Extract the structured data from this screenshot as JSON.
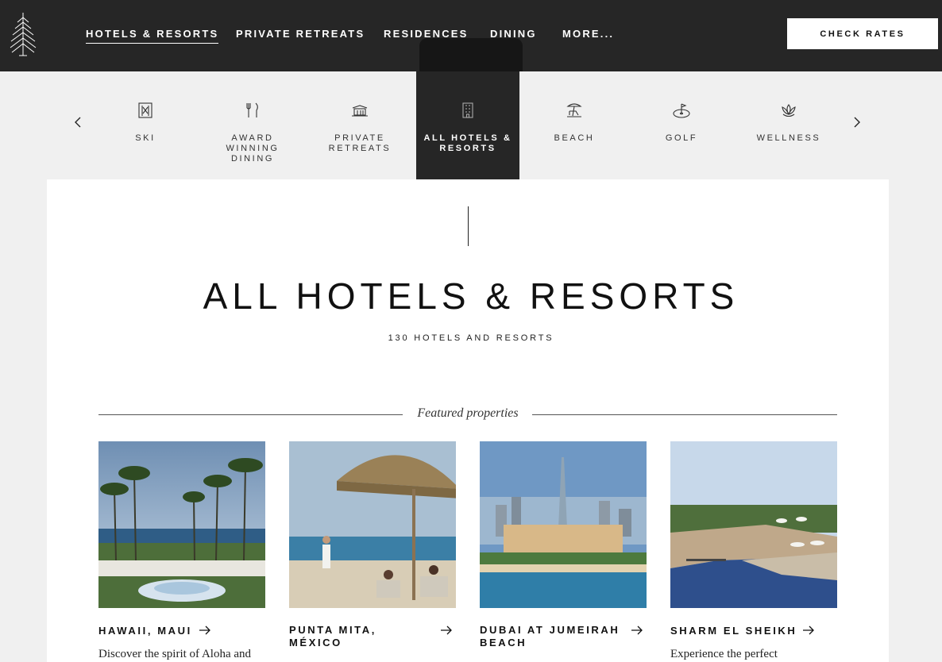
{
  "nav": {
    "items": [
      {
        "label": "HOTELS & RESORTS",
        "active": true
      },
      {
        "label": "PRIVATE RETREATS"
      },
      {
        "label": "RESIDENCES"
      },
      {
        "label": "DINING"
      },
      {
        "label": "MORE..."
      }
    ],
    "check_rates_label": "CHECK RATES"
  },
  "categories": {
    "items": [
      {
        "label": "SKI",
        "icon": "ski-icon"
      },
      {
        "label": "AWARD WINNING DINING",
        "icon": "utensils-icon"
      },
      {
        "label": "PRIVATE RETREATS",
        "icon": "villa-icon"
      },
      {
        "label": "ALL HOTELS & RESORTS",
        "icon": "building-icon",
        "active": true
      },
      {
        "label": "BEACH",
        "icon": "beach-chair-icon"
      },
      {
        "label": "GOLF",
        "icon": "golf-icon"
      },
      {
        "label": "WELLNESS",
        "icon": "lotus-icon"
      }
    ]
  },
  "main": {
    "title": "ALL HOTELS & RESORTS",
    "count": "130 HOTELS AND RESORTS",
    "featured_label": "Featured properties",
    "cards": [
      {
        "title": "HAWAII, MAUI",
        "desc": "Discover the spirit of Aloha and"
      },
      {
        "title": "PUNTA MITA, MÉXICO",
        "desc": ""
      },
      {
        "title": "DUBAI AT JUMEIRAH BEACH",
        "desc": ""
      },
      {
        "title": "SHARM EL SHEIKH",
        "desc": "Experience the perfect"
      }
    ]
  },
  "colors": {
    "nav_bg": "#262626",
    "page_bg": "#f0f0f0",
    "panel_bg": "#ffffff"
  }
}
